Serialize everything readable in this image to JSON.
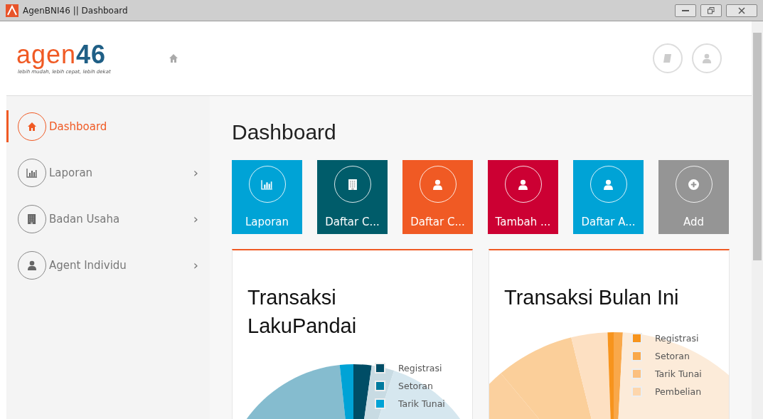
{
  "window": {
    "title": "AgenBNI46 || Dashboard"
  },
  "header": {
    "logo": {
      "part_1": "agen",
      "part_2": "46",
      "tagline": "lebih mudah, lebih cepat, lebih dekat"
    }
  },
  "sidebar": {
    "items": [
      {
        "label": "Dashboard",
        "kind": "home",
        "selected": true
      },
      {
        "label": "Laporan",
        "kind": "chart",
        "selected": false,
        "chevron": "›"
      },
      {
        "label": "Badan Usaha",
        "kind": "building",
        "selected": false,
        "chevron": "›"
      },
      {
        "label": "Agent Individu",
        "kind": "user",
        "selected": false,
        "chevron": "›"
      }
    ]
  },
  "page_title": "Dashboard",
  "tiles": [
    {
      "label": "Laporan",
      "kind": "chart",
      "color": "#00a3d6"
    },
    {
      "label": "Daftar C...",
      "kind": "building",
      "color": "#005c6a"
    },
    {
      "label": "Daftar C...",
      "kind": "user",
      "color": "#f05a24"
    },
    {
      "label": "Tambah ...",
      "kind": "user",
      "color": "#cc0033"
    },
    {
      "label": "Daftar A...",
      "kind": "user",
      "color": "#00a3d6"
    },
    {
      "label": "Add",
      "kind": "plus",
      "color": "#959595"
    }
  ],
  "cards": [
    {
      "title": "Transaksi LakuPandai",
      "legend": [
        {
          "label": "Registrasi",
          "color": "#004d66"
        },
        {
          "label": "Setoran",
          "color": "#007a9e"
        },
        {
          "label": "Tarik Tunai",
          "color": "#00a3d6"
        }
      ]
    },
    {
      "title": "Transaksi Bulan Ini",
      "legend": [
        {
          "label": "Registrasi",
          "color": "#f7941d"
        },
        {
          "label": "Setoran",
          "color": "#f9a84a"
        },
        {
          "label": "Tarik Tunai",
          "color": "#fbc080"
        },
        {
          "label": "Pembelian",
          "color": "#fdd6ac"
        }
      ]
    }
  ]
}
